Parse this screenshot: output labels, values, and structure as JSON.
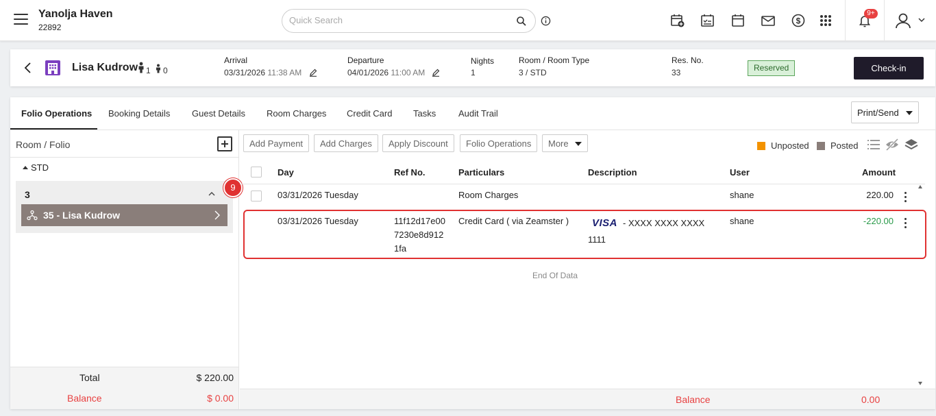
{
  "header": {
    "hotel_name": "Yanolja Haven",
    "hotel_id": "22892",
    "search_placeholder": "Quick Search",
    "notification_count": "9+"
  },
  "reservation": {
    "guest_name": "Lisa Kudrow",
    "adults": "1",
    "children": "0",
    "arrival_label": "Arrival",
    "arrival_date": "03/31/2026",
    "arrival_time": "11:38 AM",
    "departure_label": "Departure",
    "departure_date": "04/01/2026",
    "departure_time": "11:00 AM",
    "nights_label": "Nights",
    "nights": "1",
    "room_type_label": "Room / Room Type",
    "room_type": "3 / STD",
    "res_no_label": "Res. No.",
    "res_no": "33",
    "status": "Reserved",
    "checkin_label": "Check-in"
  },
  "tabs": [
    {
      "label": "Folio Operations",
      "active": true
    },
    {
      "label": "Booking Details"
    },
    {
      "label": "Guest Details"
    },
    {
      "label": "Room Charges"
    },
    {
      "label": "Credit Card"
    },
    {
      "label": "Tasks"
    },
    {
      "label": "Audit Trail"
    }
  ],
  "print_send_label": "Print/Send",
  "left_panel": {
    "title": "Room / Folio",
    "room_type": "STD",
    "room_number": "3",
    "folio_label": "35 - Lisa Kudrow",
    "step_badge": "9",
    "total_label": "Total",
    "total_value": "$ 220.00",
    "balance_label": "Balance",
    "balance_value": "$ 0.00"
  },
  "actions": {
    "add_payment": "Add Payment",
    "add_charges": "Add Charges",
    "apply_discount": "Apply Discount",
    "folio_operations": "Folio Operations",
    "more": "More"
  },
  "legend": {
    "unposted": "Unposted",
    "posted": "Posted",
    "unposted_color": "#f39200",
    "posted_color": "#8a7e7a"
  },
  "table": {
    "columns": {
      "day": "Day",
      "ref_no": "Ref No.",
      "particulars": "Particulars",
      "description": "Description",
      "user": "User",
      "amount": "Amount"
    },
    "rows": [
      {
        "day": "03/31/2026 Tuesday",
        "ref_no": "",
        "particulars": "Room Charges",
        "description": "",
        "user": "shane",
        "amount": "220.00"
      },
      {
        "day": "03/31/2026 Tuesday",
        "ref_no_1": "11f12d17e00",
        "ref_no_2": "7230e8d912",
        "ref_no_3": "1fa",
        "particulars": "Credit Card ( via Zeamster )",
        "card_brand": "VISA",
        "description_1": "- XXXX XXXX XXXX",
        "description_2": "1111",
        "user": "shane",
        "amount": "-220.00"
      }
    ],
    "end_of_data": "End Of Data"
  },
  "footer": {
    "balance_label": "Balance",
    "balance_value": "0.00"
  }
}
